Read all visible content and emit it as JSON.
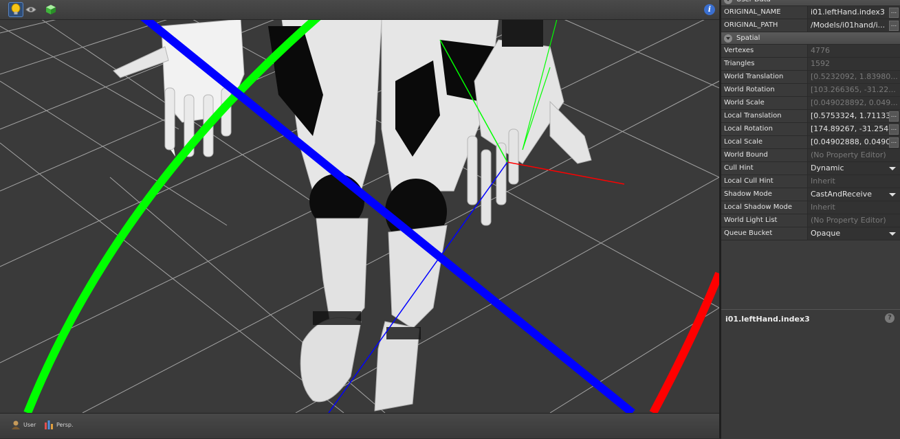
{
  "viewport": {
    "toolbar": {
      "light_icon": "lightbulb-icon",
      "eye_icon": "eye-icon",
      "cube_icon": "cube-icon",
      "info_icon": "info-icon",
      "info_glyph": "i"
    },
    "statusbar": {
      "camera_mode_label": "User",
      "projection_label": "Persp."
    },
    "axis_colors": {
      "x": "#ff0000",
      "y": "#00ff00",
      "z": "#0000ff"
    }
  },
  "properties": {
    "sections": [
      {
        "title": "User Data",
        "rows": [
          {
            "key": "ORIGINAL_NAME",
            "value": "i01.leftHand.index3",
            "dim": false,
            "editor": "ellipsis"
          },
          {
            "key": "ORIGINAL_PATH",
            "value": "/Models/i01hand/i...",
            "dim": false,
            "editor": "ellipsis"
          }
        ]
      },
      {
        "title": "Spatial",
        "rows": [
          {
            "key": "Vertexes",
            "value": "4776",
            "dim": true
          },
          {
            "key": "Triangles",
            "value": "1592",
            "dim": true
          },
          {
            "key": "World Translation",
            "value": "[0.5232092, 1.83980...",
            "dim": true
          },
          {
            "key": "World Rotation",
            "value": "[103.266365, -31.22...",
            "dim": true
          },
          {
            "key": "World Scale",
            "value": "[0.049028892, 0.049...",
            "dim": true
          },
          {
            "key": "Local Translation",
            "value": "[0.5753324, 1.71133...",
            "dim": false,
            "editor": "ellipsis"
          },
          {
            "key": "Local Rotation",
            "value": "[174.89267, -31.254...",
            "dim": false,
            "editor": "ellipsis"
          },
          {
            "key": "Local Scale",
            "value": "[0.04902888, 0.0490...",
            "dim": false,
            "editor": "ellipsis"
          },
          {
            "key": "World Bound",
            "value": "(No Property Editor)",
            "dim": true
          },
          {
            "key": "Cull Hint",
            "value": "Dynamic",
            "dim": false,
            "editor": "dropdown"
          },
          {
            "key": "Local Cull Hint",
            "value": "Inherit",
            "dim": true
          },
          {
            "key": "Shadow Mode",
            "value": "CastAndReceive",
            "dim": false,
            "editor": "dropdown"
          },
          {
            "key": "Local Shadow Mode",
            "value": "Inherit",
            "dim": true
          },
          {
            "key": "World Light List",
            "value": "(No Property Editor)",
            "dim": true
          },
          {
            "key": "Queue Bucket",
            "value": "Opaque",
            "dim": false,
            "editor": "dropdown"
          }
        ]
      }
    ],
    "ellipsis_label": "...",
    "collapse_icon": "collapse-chevron-icon"
  },
  "description": {
    "title": "i01.leftHand.index3",
    "help_icon": "help-icon",
    "help_glyph": "?"
  }
}
